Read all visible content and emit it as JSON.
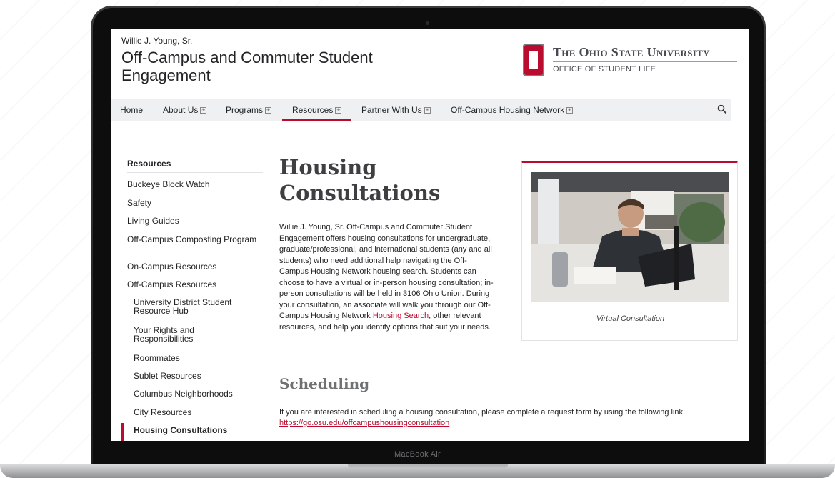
{
  "header": {
    "department_sub": "Willie J. Young, Sr.",
    "department_name": "Off-Campus and Commuter Student Engagement",
    "university": "The Ohio State University",
    "office": "OFFICE OF STUDENT LIFE"
  },
  "nav": {
    "items": [
      {
        "label": "Home",
        "expandable": false
      },
      {
        "label": "About Us",
        "expandable": true
      },
      {
        "label": "Programs",
        "expandable": true
      },
      {
        "label": "Resources",
        "expandable": true,
        "active": true
      },
      {
        "label": "Partner With Us",
        "expandable": true
      },
      {
        "label": "Off-Campus Housing Network",
        "expandable": true
      }
    ],
    "search_icon": "search-icon"
  },
  "sidebar": {
    "title": "Resources",
    "items": [
      {
        "label": "Buckeye Block Watch"
      },
      {
        "label": "Safety"
      },
      {
        "label": "Living Guides"
      },
      {
        "label": "Off-Campus Composting Program"
      },
      {
        "label": "On-Campus Resources"
      },
      {
        "label": "Off-Campus Resources"
      },
      {
        "label": "University District Student Resource Hub"
      },
      {
        "label": "Your Rights and Responsibilities"
      },
      {
        "label": "Roommates"
      },
      {
        "label": "Sublet Resources"
      },
      {
        "label": "Columbus Neighborhoods"
      },
      {
        "label": "City Resources"
      },
      {
        "label": "Housing Consultations",
        "active": true
      }
    ]
  },
  "main": {
    "title": "Housing Consultations",
    "intro_before_link": "Willie J. Young, Sr. Off-Campus and Commuter Student Engagement offers housing consultations for undergraduate, graduate/professional, and international students (any and all students) who need additional help navigating the Off-Campus Housing Network housing search. Students can choose to have a virtual or in-person housing consultation; in-person consultations will be held in 3106 Ohio Union. During your consultation, an associate will walk you through our Off-Campus Housing Network ",
    "intro_link": "Housing Search",
    "intro_after_link": ", other relevant resources, and help you identify options that suit your needs.",
    "scheduling_title": "Scheduling",
    "scheduling_text": "If you are interested in scheduling a housing consultation, please complete a request form by using the following link:",
    "scheduling_link": "https://go.osu.edu/offcampushousingconsultation",
    "figure_caption": "Virtual Consultation"
  },
  "device": {
    "label": "MacBook Air"
  },
  "colors": {
    "accent": "#ba0c2f",
    "nav_bg": "#eef0f1",
    "text": "#212325"
  }
}
